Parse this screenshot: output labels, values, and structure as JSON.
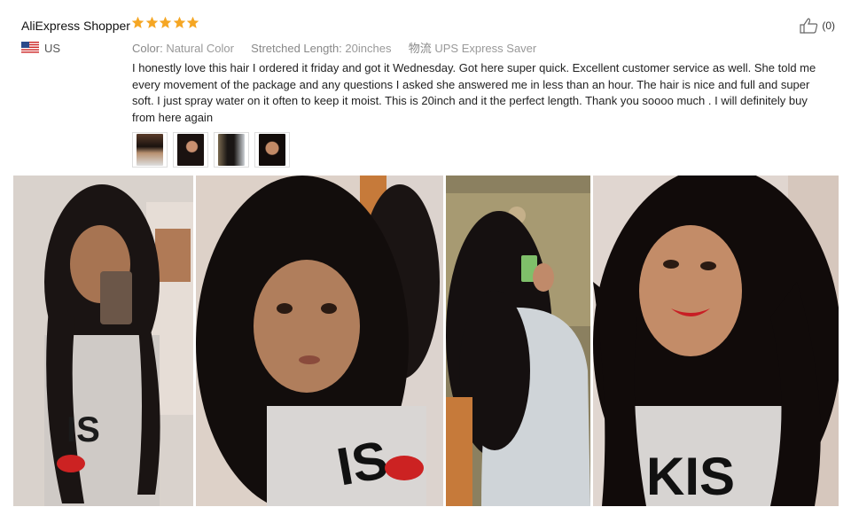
{
  "review": {
    "reviewer": "AliExpress Shopper",
    "country": "US",
    "rating_stars": 5,
    "like_count": "(0)",
    "color_label": "Color:",
    "color_value": "Natural Color",
    "length_label": "Stretched Length:",
    "length_value": "20inches",
    "shipping_label": "物流",
    "shipping_value": "UPS Express Saver",
    "text": "I honestly love this hair I ordered it friday and got it Wednesday. Got here super quick. Excellent customer service as well. She told me every movement of the package and any questions I asked she answered me in less than an hour. The hair is nice and full and super soft. I just spray water on it often to keep it moist. This is 20inch and it the perfect length. Thank you soooo much . I will definitely buy from here again"
  },
  "colors": {
    "star": "#f5a623",
    "thumb_border": "#dddddd",
    "text": "#222222",
    "muted": "#999999"
  },
  "icons": {
    "rating": "star-icon",
    "flag": "us-flag-icon",
    "like": "thumbs-up-icon"
  },
  "thumbnails": [
    {
      "name": "review-photo-thumb-1"
    },
    {
      "name": "review-photo-thumb-2"
    },
    {
      "name": "review-photo-thumb-3"
    },
    {
      "name": "review-photo-thumb-4"
    }
  ]
}
